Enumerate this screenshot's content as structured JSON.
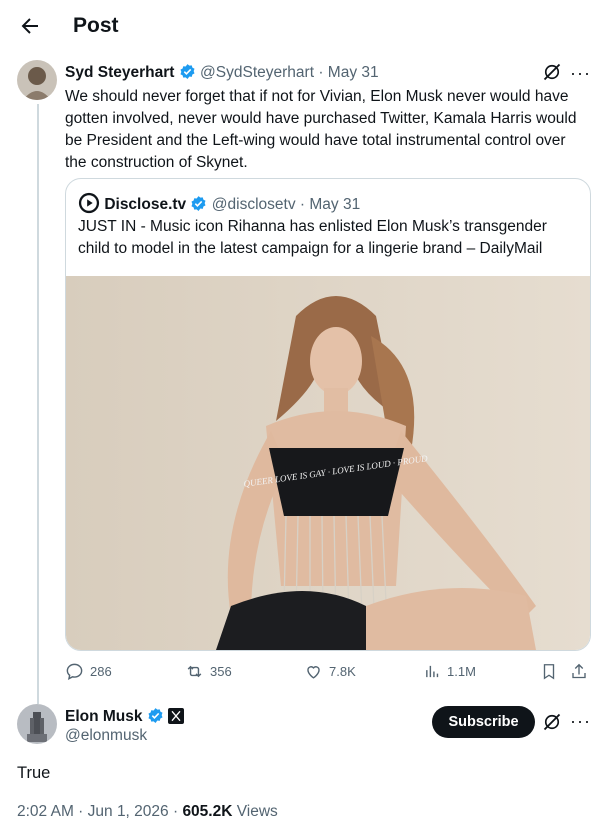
{
  "header": {
    "title": "Post"
  },
  "parent_post": {
    "author_name": "Syd Steyerhart",
    "handle": "@SydSteyerhart",
    "separator": "·",
    "date": "May 31",
    "text": "We should never forget that if not for Vivian, Elon Musk never would have gotten involved, never would have purchased Twitter, Kamala Harris would be President and the Left-wing would have total instrumental control over the construction of Skynet.",
    "quote": {
      "author_name": "Disclose.tv",
      "handle": "@disclosetv",
      "separator": "·",
      "date": "May 31",
      "text": "JUST IN - Music icon Rihanna has enlisted Elon Musk’s transgender child to model in the latest campaign for a lingerie brand – DailyMail",
      "shirt_text": "QUEER LOVE IS GAY · LOVE IS LOUD · PROUD"
    },
    "metrics": {
      "replies": "286",
      "reposts": "356",
      "likes": "7.8K",
      "views": "1.1M"
    }
  },
  "main_post": {
    "author_name": "Elon Musk",
    "handle": "@elonmusk",
    "subscribe_label": "Subscribe",
    "text": "True",
    "time": "2:02 AM · Jun 1, 2026 · ",
    "views_count": "605.2K",
    "views_label": " Views"
  },
  "colors": {
    "accent": "#1d9bf0",
    "muted": "#536471",
    "border": "#cfd9de"
  }
}
